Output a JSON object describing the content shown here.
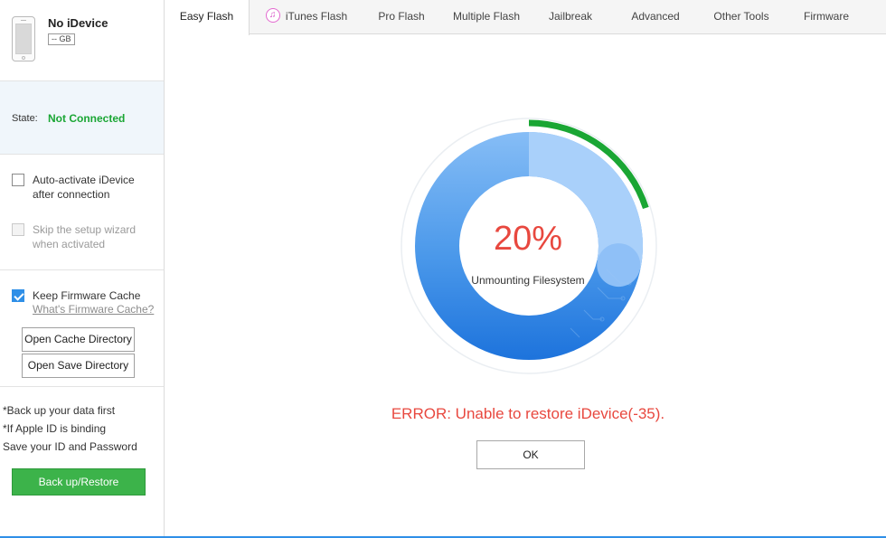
{
  "device": {
    "name": "No iDevice",
    "storage": "-- GB"
  },
  "state": {
    "label": "State:",
    "value": "Not Connected",
    "value_color": "#1aa634"
  },
  "options": {
    "auto_activate": {
      "label": "Auto-activate iDevice after connection",
      "checked": false
    },
    "skip_wizard": {
      "label": "Skip the setup wizard when activated",
      "checked": false,
      "disabled": true
    },
    "keep_cache": {
      "label": "Keep Firmware Cache",
      "checked": true,
      "link": "What's Firmware Cache?"
    }
  },
  "buttons": {
    "open_cache": "Open Cache Directory",
    "open_save": "Open Save Directory",
    "backup_restore": "Back up/Restore",
    "ok": "OK"
  },
  "notes": [
    "*Back up your data first",
    "*If Apple ID is binding",
    "Save your ID and Password"
  ],
  "tabs": [
    {
      "label": "Easy Flash",
      "active": true
    },
    {
      "label": "iTunes Flash",
      "icon": "itunes-icon"
    },
    {
      "label": "Pro Flash"
    },
    {
      "label": "Multiple Flash"
    },
    {
      "label": "Jailbreak"
    },
    {
      "label": "Advanced"
    },
    {
      "label": "Other Tools"
    },
    {
      "label": "Firmware"
    }
  ],
  "progress": {
    "percent_text": "20%",
    "percent": 20,
    "stage": "Unmounting Filesystem",
    "color": "#1aa634"
  },
  "error": {
    "message": "ERROR: Unable to restore iDevice(-35).",
    "color": "#e8483f"
  },
  "colors": {
    "accent": "#2f8fe7",
    "success": "#3cb34a"
  }
}
